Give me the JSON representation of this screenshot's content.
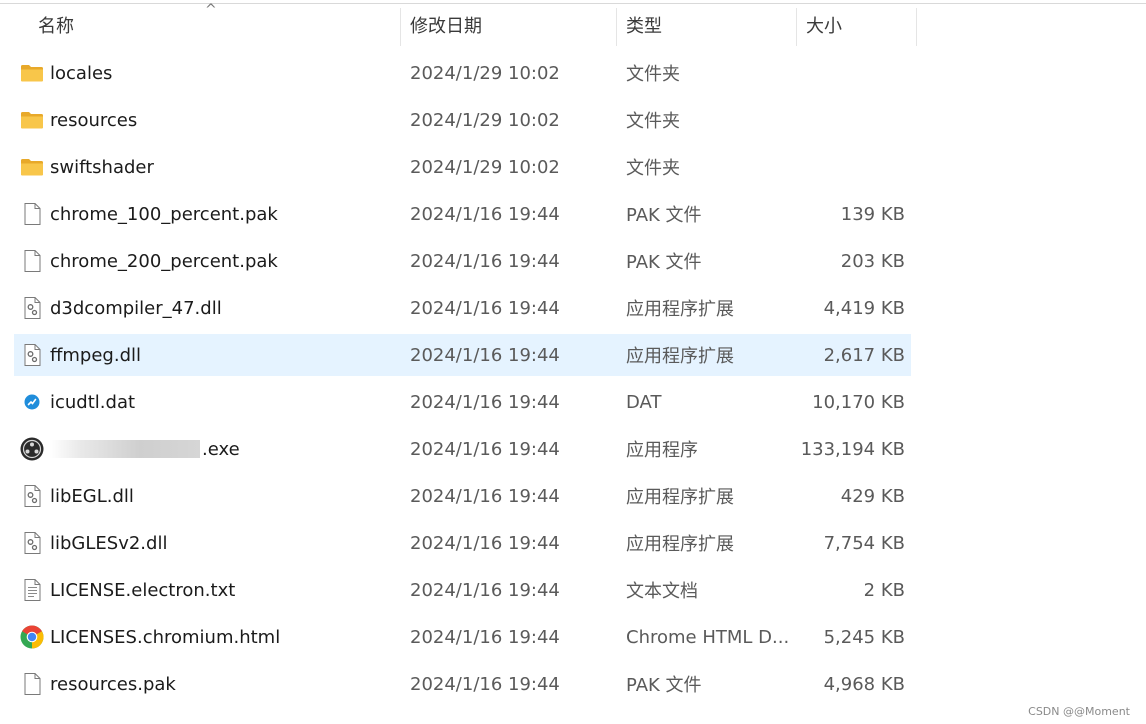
{
  "header": {
    "columns": [
      {
        "label": "名称"
      },
      {
        "label": "修改日期"
      },
      {
        "label": "类型"
      },
      {
        "label": "大小"
      }
    ]
  },
  "files": [
    {
      "name": "locales",
      "date": "2024/1/29 10:02",
      "type": "文件夹",
      "size": "",
      "icon": "folder-icon"
    },
    {
      "name": "resources",
      "date": "2024/1/29 10:02",
      "type": "文件夹",
      "size": "",
      "icon": "folder-icon"
    },
    {
      "name": "swiftshader",
      "date": "2024/1/29 10:02",
      "type": "文件夹",
      "size": "",
      "icon": "folder-icon"
    },
    {
      "name": "chrome_100_percent.pak",
      "date": "2024/1/16 19:44",
      "type": "PAK 文件",
      "size": "139 KB",
      "icon": "file-icon"
    },
    {
      "name": "chrome_200_percent.pak",
      "date": "2024/1/16 19:44",
      "type": "PAK 文件",
      "size": "203 KB",
      "icon": "file-icon"
    },
    {
      "name": "d3dcompiler_47.dll",
      "date": "2024/1/16 19:44",
      "type": "应用程序扩展",
      "size": "4,419 KB",
      "icon": "dll-icon"
    },
    {
      "name": "ffmpeg.dll",
      "date": "2024/1/16 19:44",
      "type": "应用程序扩展",
      "size": "2,617 KB",
      "icon": "dll-icon",
      "selected": true
    },
    {
      "name": "icudtl.dat",
      "date": "2024/1/16 19:44",
      "type": "DAT",
      "size": "10,170 KB",
      "icon": "dat-icon"
    },
    {
      "name": ".exe",
      "date": "2024/1/16 19:44",
      "type": "应用程序",
      "size": "133,194 KB",
      "icon": "app-icon",
      "redacted": true
    },
    {
      "name": "libEGL.dll",
      "date": "2024/1/16 19:44",
      "type": "应用程序扩展",
      "size": "429 KB",
      "icon": "dll-icon"
    },
    {
      "name": "libGLESv2.dll",
      "date": "2024/1/16 19:44",
      "type": "应用程序扩展",
      "size": "7,754 KB",
      "icon": "dll-icon"
    },
    {
      "name": "LICENSE.electron.txt",
      "date": "2024/1/16 19:44",
      "type": "文本文档",
      "size": "2 KB",
      "icon": "text-file-icon"
    },
    {
      "name": "LICENSES.chromium.html",
      "date": "2024/1/16 19:44",
      "type": "Chrome HTML D...",
      "size": "5,245 KB",
      "icon": "chrome-icon"
    },
    {
      "name": "resources.pak",
      "date": "2024/1/16 19:44",
      "type": "PAK 文件",
      "size": "4,968 KB",
      "icon": "file-icon"
    }
  ],
  "watermark": "CSDN @@Moment",
  "colors": {
    "selected_row": "#e5f3ff",
    "folder": "#f8c64a"
  }
}
